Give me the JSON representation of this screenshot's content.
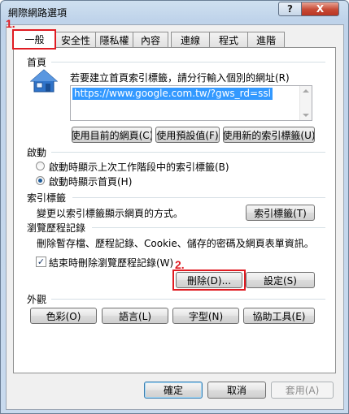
{
  "window": {
    "title": "網際網路選項",
    "help_glyph": "?",
    "close_glyph": "X"
  },
  "tabs": [
    {
      "label": "一般",
      "active": true
    },
    {
      "label": "安全性"
    },
    {
      "label": "隱私權"
    },
    {
      "label": "內容"
    },
    {
      "label": "連線"
    },
    {
      "label": "程式"
    },
    {
      "label": "進階"
    }
  ],
  "home_page": {
    "heading": "首頁",
    "description": "若要建立首頁索引標籤，請分行輸入個別的網址(R)",
    "url": "https://www.google.com.tw/?gws_rd=ssl",
    "buttons": {
      "use_current": "使用目前的網頁(C)",
      "use_default": "使用預設值(F)",
      "use_new_tab": "使用新的索引標籤(U)"
    }
  },
  "startup": {
    "heading": "啟動",
    "options": [
      {
        "label": "啟動時顯示上次工作階段中的索引標籤(B)",
        "selected": false
      },
      {
        "label": "啟動時顯示首頁(H)",
        "selected": true
      }
    ]
  },
  "tabs_section": {
    "heading": "索引標籤",
    "description": "變更以索引標籤顯示網頁的方式。",
    "button": "索引標籤(T)"
  },
  "history": {
    "heading": "瀏覽歷程記錄",
    "description": "刪除暫存檔、歷程記錄、Cookie、儲存的密碼及網頁表單資訊。",
    "checkbox_label": "結束時刪除瀏覽歷程記錄(W)",
    "checkbox_checked": true,
    "check_glyph": "✓",
    "delete_button": "刪除(D)...",
    "settings_button": "設定(S)"
  },
  "appearance": {
    "heading": "外觀",
    "buttons": [
      "色彩(O)",
      "語言(L)",
      "字型(N)",
      "協助工具(E)"
    ]
  },
  "footer": {
    "ok": "確定",
    "cancel": "取消",
    "apply": "套用(A)"
  },
  "annotations": {
    "marker_1": "1.",
    "marker_2": "2.",
    "color": "#e01b22"
  },
  "colors": {
    "url_selection": "#3399ff",
    "title_bar": "#bfd3ea",
    "close_button": "#c74a35"
  },
  "icons": {
    "home": "home-icon"
  }
}
